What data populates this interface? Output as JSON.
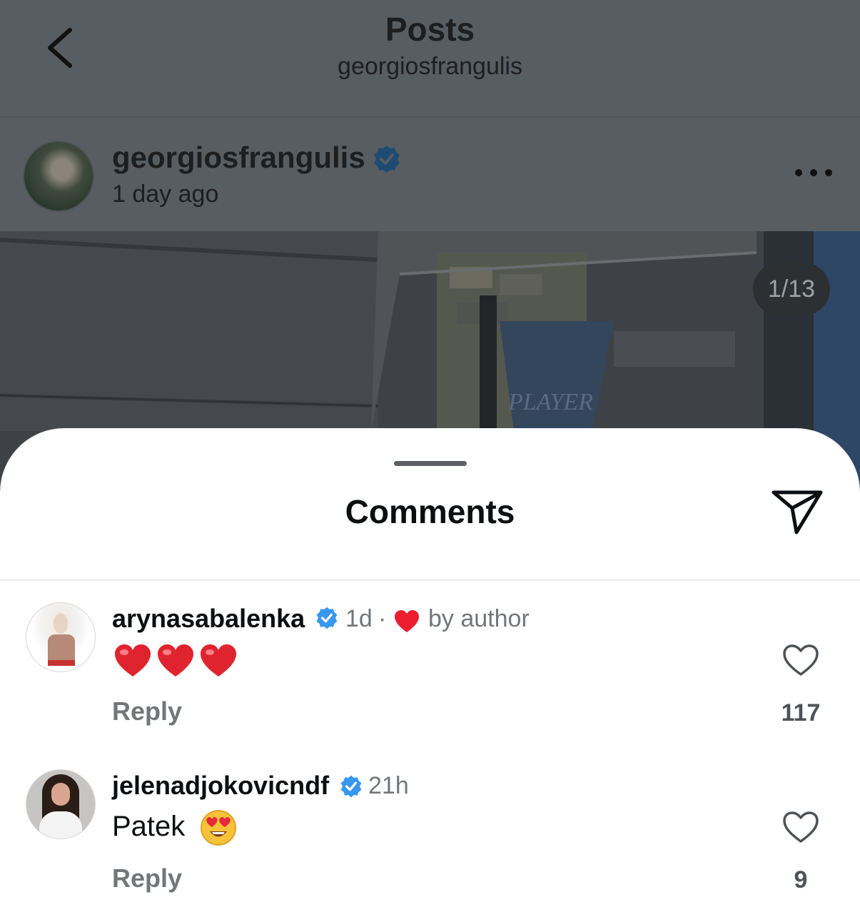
{
  "nav": {
    "title": "Posts",
    "subtitle": "georgiosfrangulis"
  },
  "post": {
    "username": "georgiosfrangulis",
    "time": "1 day ago",
    "counter": "1/13",
    "photo_sign_text": "PLAYER"
  },
  "sheet": {
    "title": "Comments"
  },
  "comments": [
    {
      "username": "arynasabalenka",
      "time": "1d",
      "separator": "·",
      "liked_by": "by author",
      "text_emojis": [
        "red-heart",
        "red-heart",
        "red-heart"
      ],
      "reply_label": "Reply",
      "likes": "117"
    },
    {
      "username": "jelenadjokovicndf",
      "time": "21h",
      "text": "Patek",
      "text_emoji": "heart-eyes-face",
      "reply_label": "Reply",
      "likes": "9"
    }
  ],
  "colors": {
    "dim_overlay": "#585d61",
    "verified_blue": "#3897f0",
    "heart_red": "#ed1d2f",
    "secondary_text": "#737679"
  }
}
